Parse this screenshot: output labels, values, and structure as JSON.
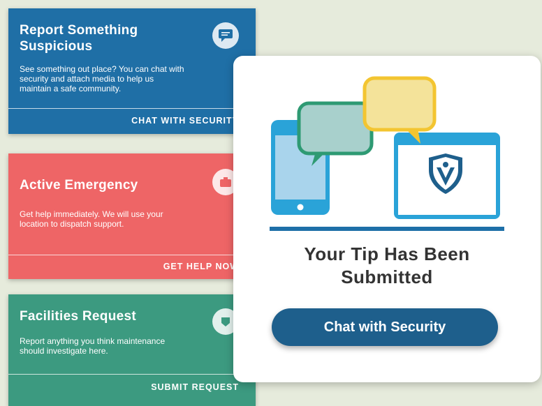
{
  "cards": [
    {
      "title_line1": "Report Something",
      "title_line2": "Suspicious",
      "description_line1": "See something out place? You can chat with",
      "description_line2": "security and attach media to help us",
      "description_line3": "maintain a safe community.",
      "action_label": "CHAT WITH SECURITY",
      "icon": "chat-bubble-icon",
      "color": "#1f6fa6"
    },
    {
      "title": "Active Emergency",
      "description_line1": "Get help immediately. We will use your",
      "description_line2": "location to dispatch support.",
      "action_label": "GET HELP NOW",
      "icon": "emergency-icon",
      "color": "#ee6566"
    },
    {
      "title": "Facilities Request",
      "description_line1": "Report anything you think maintenance",
      "description_line2": "should investigate here.",
      "action_label": "SUBMIT REQUEST",
      "icon": "maintenance-icon",
      "color": "#3c9a80"
    }
  ],
  "modal": {
    "headline_line1": "Your Tip Has Been",
    "headline_line2": "Submitted",
    "button_label": "Chat with Security",
    "illustration": "phone-and-browser-chat-illustration",
    "button_color": "#1e5f8c"
  }
}
